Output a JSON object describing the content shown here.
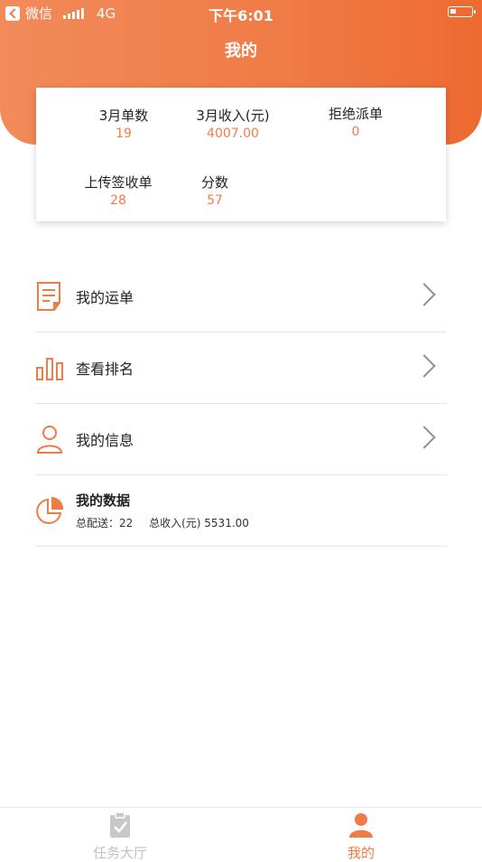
{
  "status_bar": {
    "back_app": "微信",
    "network": "4G",
    "time": "下午6:01"
  },
  "header": {
    "title": "我的"
  },
  "stats": [
    {
      "label": "3月单数",
      "value": "19"
    },
    {
      "label": "3月收入(元)",
      "value": "4007.00"
    },
    {
      "label": "拒绝派单",
      "value": "0"
    },
    {
      "label": "上传签收单",
      "value": "28"
    },
    {
      "label": "分数",
      "value": "57"
    }
  ],
  "menu": {
    "waybill": {
      "label": "我的运单",
      "icon": "document-icon"
    },
    "ranking": {
      "label": "查看排名",
      "icon": "bar-chart-icon"
    },
    "info": {
      "label": "我的信息",
      "icon": "user-icon"
    },
    "data": {
      "label": "我的数据",
      "icon": "pie-chart-icon",
      "total_delivery": "总配送：22",
      "total_income": "总收入(元) 5531.00"
    }
  },
  "tabbar": {
    "tabs": [
      {
        "label": "任务大厅",
        "icon": "clipboard-check-icon",
        "active": false
      },
      {
        "label": "我的",
        "icon": "user-icon",
        "active": true
      }
    ]
  },
  "colors": {
    "accent": "#ef7b45",
    "header": "#f08656"
  }
}
